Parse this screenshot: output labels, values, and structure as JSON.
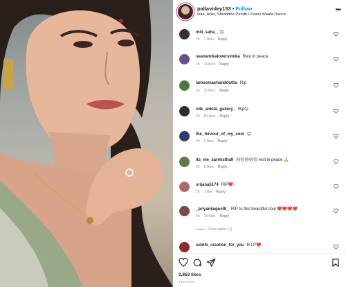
{
  "post": {
    "username": "pallavidey153",
    "separator": "•",
    "follow_label": "Follow",
    "audio": "Ikka, Arko, Shraddha Pandit • Paani Waala Dance"
  },
  "comments": [
    {
      "user": "mili_saha_",
      "text": "😊",
      "time": "2h",
      "likes": "7 likes",
      "reply": "Reply",
      "avatar_color": "#3a3030"
    },
    {
      "user": "seanamikaloversimika",
      "text": "Rest in peace",
      "time": "2h",
      "likes": "11 likes",
      "reply": "Reply",
      "avatar_color": "#6a4f8a"
    },
    {
      "user": "iamsomachandduttia",
      "text": "Rip",
      "time": "2h",
      "likes": "11 likes",
      "reply": "Reply",
      "avatar_color": "#4a7a3a"
    },
    {
      "user": "vdk_ankita_gallery_",
      "text": "Rip😔",
      "time": "2h",
      "likes": "59 likes",
      "reply": "Reply",
      "avatar_color": "#2c2c2c"
    },
    {
      "user": "the_fervour_of_my_soul",
      "text": "😊",
      "time": "2h",
      "likes": "6 likes",
      "reply": "Reply",
      "avatar_color": "#2d3c6a"
    },
    {
      "user": "its_me_sarmistha9",
      "text": "😔😔😔😔😔 rest in peace 🙏",
      "time": "2h",
      "likes": "8 likes",
      "reply": "Reply",
      "avatar_color": "#5c7a4a"
    },
    {
      "user": "srijana5174",
      "text": "RIP❤️",
      "time": "2h",
      "likes": "1 like",
      "reply": "Reply",
      "avatar_color": "#a86a6a"
    },
    {
      "user": "_priyankagoel8_",
      "text": "RIP to this beautiful soul ❤️❤️❤️❤️",
      "time": "4h",
      "likes": "15 likes",
      "reply": "Reply",
      "avatar_color": "#7a4a4a",
      "view_replies": "View replies (1)"
    },
    {
      "user": "siddhi_creation_for_you",
      "text": "R.I.P❤️",
      "time": "",
      "likes": "",
      "reply": "",
      "avatar_color": "#8a2a2a"
    }
  ],
  "footer": {
    "likes": "2,853 likes",
    "time": "1 DAY AGO"
  },
  "icons": {
    "heart": "heart-icon",
    "comment": "comment-icon",
    "share": "share-icon",
    "save": "bookmark-icon",
    "more": "more-icon"
  },
  "colors": {
    "follow": "#0095f6",
    "heart_red": "#ed4956",
    "meta_gray": "#8e8e8e"
  }
}
